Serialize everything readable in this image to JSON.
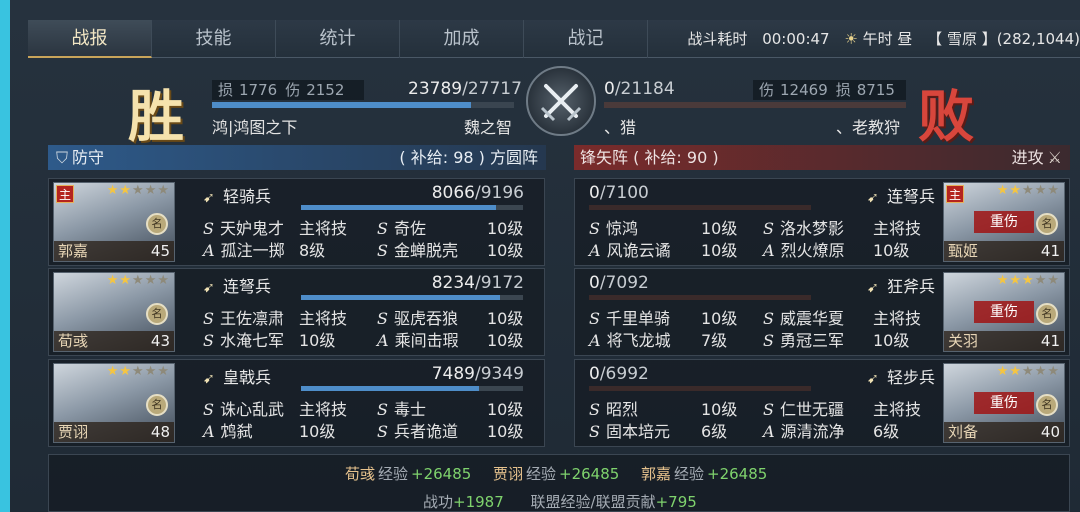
{
  "tabs": [
    "战报",
    "技能",
    "统计",
    "加成",
    "战记"
  ],
  "active_tab": 0,
  "battle": {
    "duration_label": "战斗耗时",
    "duration": "00:00:47",
    "time": "午时 昼",
    "location": "【 雪原 】(282,1044)"
  },
  "left": {
    "result": "胜",
    "loss_label": "损",
    "loss": "1776",
    "dmg_label": "伤",
    "dmg": "2152",
    "hp_cur": "23789",
    "hp_max": "/27717",
    "hp_frac": 0.858,
    "alliance": "鸿|鸿图之下",
    "player": "魏之智",
    "header": "防守",
    "supply": "( 补给: 98 ) 方圆阵",
    "units": [
      {
        "name": "郭嘉",
        "level": "45",
        "stars": 2,
        "badge": "主",
        "troop_type": "轻骑兵",
        "cur": "8066",
        "max": "/9196",
        "frac": 0.877,
        "skills": [
          [
            "S",
            "天妒鬼才",
            "主将技"
          ],
          [
            "S",
            "奇佐",
            "10级"
          ],
          [
            "A",
            "孤注一掷",
            "8级"
          ],
          [
            "S",
            "金蝉脱壳",
            "10级"
          ]
        ]
      },
      {
        "name": "荀彧",
        "level": "43",
        "stars": 2,
        "badge": "",
        "troop_type": "连弩兵",
        "cur": "8234",
        "max": "/9172",
        "frac": 0.898,
        "skills": [
          [
            "S",
            "王佐凛肃",
            "主将技"
          ],
          [
            "S",
            "驱虎吞狼",
            "10级"
          ],
          [
            "S",
            "水淹七军",
            "10级"
          ],
          [
            "A",
            "乘间击瑕",
            "10级"
          ]
        ]
      },
      {
        "name": "贾诩",
        "level": "48",
        "stars": 2,
        "badge": "",
        "troop_type": "皇戟兵",
        "cur": "7489",
        "max": "/9349",
        "frac": 0.801,
        "skills": [
          [
            "S",
            "诛心乱武",
            "主将技"
          ],
          [
            "S",
            "毒士",
            "10级"
          ],
          [
            "A",
            "鸩弑",
            "10级"
          ],
          [
            "S",
            "兵者诡道",
            "10级"
          ]
        ]
      }
    ]
  },
  "right": {
    "result": "败",
    "hp_cur": "0",
    "hp_max": "/21184",
    "dmg_label": "伤",
    "dmg": "12469",
    "loss_label": "损",
    "loss": "8715",
    "alliance": "、猎",
    "player": "、老教狩",
    "header": "锋矢阵 ( 补给: 90 )",
    "action": "进攻",
    "units": [
      {
        "name": "甄姬",
        "level": "41",
        "stars": 2,
        "badge": "主",
        "injured": "重伤",
        "troop_type": "连弩兵",
        "cur": "0",
        "max": "/7100",
        "skills": [
          [
            "S",
            "惊鸿",
            "10级"
          ],
          [
            "S",
            "洛水梦影",
            "主将技"
          ],
          [
            "A",
            "风诡云谲",
            "10级"
          ],
          [
            "A",
            "烈火燎原",
            "10级"
          ]
        ]
      },
      {
        "name": "关羽",
        "level": "41",
        "stars": 3,
        "badge": "",
        "injured": "重伤",
        "troop_type": "狂斧兵",
        "cur": "0",
        "max": "/7092",
        "skills": [
          [
            "S",
            "千里单骑",
            "10级"
          ],
          [
            "S",
            "威震华夏",
            "主将技"
          ],
          [
            "A",
            "将飞龙城",
            "7级"
          ],
          [
            "S",
            "勇冠三军",
            "10级"
          ]
        ]
      },
      {
        "name": "刘备",
        "level": "40",
        "stars": 2,
        "badge": "",
        "injured": "重伤",
        "troop_type": "轻步兵",
        "cur": "0",
        "max": "/6992",
        "skills": [
          [
            "S",
            "昭烈",
            "10级"
          ],
          [
            "S",
            "仁世无疆",
            "主将技"
          ],
          [
            "S",
            "固本培元",
            "6级"
          ],
          [
            "A",
            "源清流净",
            "6级"
          ]
        ]
      }
    ]
  },
  "footer": {
    "exp": [
      {
        "name": "荀彧",
        "label": "经验",
        "value": "+26485"
      },
      {
        "name": "贾诩",
        "label": "经验",
        "value": "+26485"
      },
      {
        "name": "郭嘉",
        "label": "经验",
        "value": "+26485"
      }
    ],
    "merit_label": "战功",
    "merit": "+1987",
    "alliance_label": "联盟经验/联盟贡献",
    "alliance_value": "+795"
  },
  "seal_text": "名",
  "colors": {
    "blue_bar": "#4e8dc9",
    "red_bar": "#8a2f2a",
    "exp_green": "#7fd36d"
  }
}
